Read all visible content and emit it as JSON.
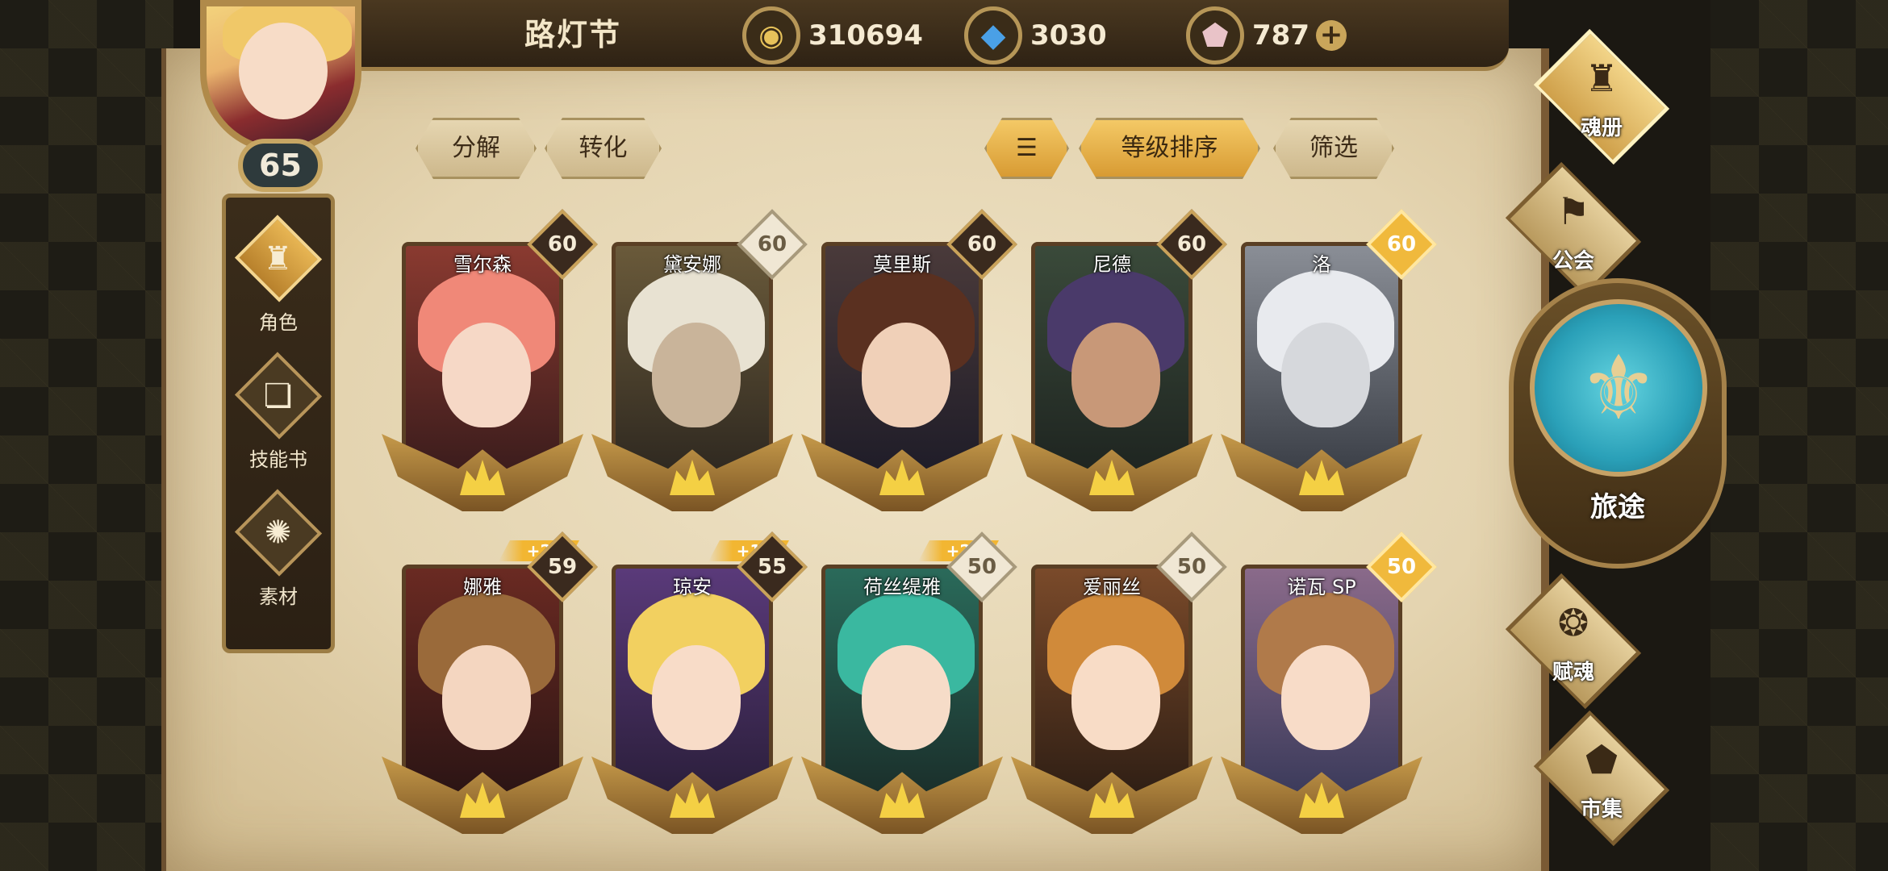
{
  "event_title": "路灯节",
  "currencies": [
    {
      "name": "gold",
      "icon": "gold-coin-icon",
      "value": "310694"
    },
    {
      "name": "crystal",
      "icon": "blue-crystal-icon",
      "value": "3030"
    },
    {
      "name": "gem",
      "icon": "pink-gem-icon",
      "value": "787"
    }
  ],
  "plus_label": "+",
  "player": {
    "level": "65"
  },
  "sidenav": [
    {
      "label": "角色",
      "icon": "helmet-icon",
      "active": true
    },
    {
      "label": "技能书",
      "icon": "book-icon",
      "active": false
    },
    {
      "label": "素材",
      "icon": "material-icon",
      "active": false
    }
  ],
  "actions": {
    "decompose": "分解",
    "convert": "转化",
    "sort_icon": "sort-icon",
    "sort_by_level": "等级排序",
    "filter": "筛选"
  },
  "cards": [
    {
      "name": "雪尔森",
      "level": "60",
      "badge": "dark",
      "bonus": ""
    },
    {
      "name": "黛安娜",
      "level": "60",
      "badge": "light",
      "bonus": ""
    },
    {
      "name": "莫里斯",
      "level": "60",
      "badge": "dark",
      "bonus": ""
    },
    {
      "name": "尼德",
      "level": "60",
      "badge": "dark",
      "bonus": ""
    },
    {
      "name": "洛",
      "level": "60",
      "badge": "gold",
      "bonus": ""
    },
    {
      "name": "娜雅",
      "level": "59",
      "badge": "dark",
      "bonus": "+2"
    },
    {
      "name": "琼安",
      "level": "55",
      "badge": "dark",
      "bonus": "+1"
    },
    {
      "name": "荷丝缇雅",
      "level": "50",
      "badge": "light",
      "bonus": "+2"
    },
    {
      "name": "爱丽丝",
      "level": "50",
      "badge": "light",
      "bonus": ""
    },
    {
      "name": "诺瓦 SP",
      "level": "50",
      "badge": "gold",
      "bonus": ""
    }
  ],
  "rightmenu": [
    {
      "label": "魂册",
      "icon": "soul-book-icon",
      "active": true
    },
    {
      "label": "公会",
      "icon": "guild-icon",
      "active": false
    },
    {
      "label": "赋魂",
      "icon": "soul-infuse-icon",
      "active": false
    },
    {
      "label": "市集",
      "icon": "market-icon",
      "active": false
    }
  ],
  "journey": {
    "label": "旅途",
    "icon": "journey-emblem-icon"
  },
  "colors": {
    "gold_accent": "#f0b93c",
    "parchment": "#e8dabc",
    "dark_wood": "#2e2214",
    "orb": "#2aa0b8"
  }
}
